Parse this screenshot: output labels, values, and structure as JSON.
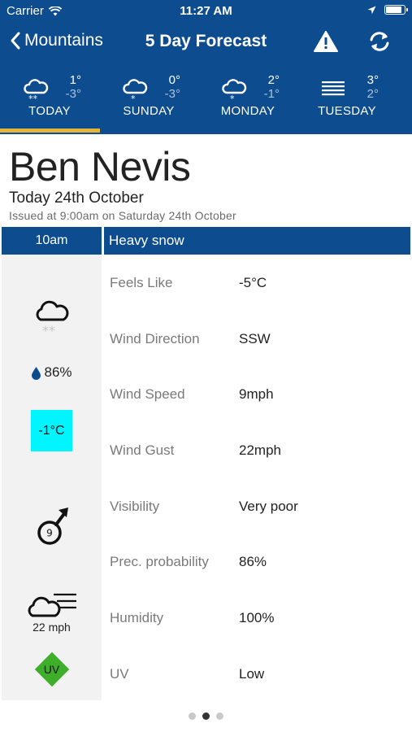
{
  "status_bar": {
    "carrier": "Carrier",
    "time": "11:27 AM"
  },
  "nav": {
    "back_label": "Mountains",
    "title": "5 Day Forecast",
    "warning_icon": "warning-triangle-icon",
    "refresh_icon": "refresh-icon"
  },
  "days": [
    {
      "label": "TODAY",
      "high": "1°",
      "low": "-3°",
      "icon": "heavy-snow-icon"
    },
    {
      "label": "SUNDAY",
      "high": "0°",
      "low": "-3°",
      "icon": "light-snow-icon"
    },
    {
      "label": "MONDAY",
      "high": "2°",
      "low": "-1°",
      "icon": "light-snow-icon"
    },
    {
      "label": "TUESDAY",
      "high": "3°",
      "low": "2°",
      "icon": "mist-icon"
    }
  ],
  "location": "Ben Nevis",
  "date": "Today 24th October",
  "issued": "Issued at 9:00am on Saturday 24th October",
  "forecast": {
    "time": "10am",
    "weather": "Heavy snow",
    "humidity_badge": "86%",
    "temperature_badge": "-1°C",
    "wind_direction_number": "9",
    "wind_badge": "22 mph",
    "uv_badge": "UV",
    "colors": {
      "temp_badge_bg": "#00f5ff",
      "uv_badge_bg": "#3fae2a",
      "header_bg": "#0d4c8f",
      "tab_indicator": "#e3b33a"
    }
  },
  "details": [
    {
      "label": "Feels Like",
      "value": "-5°C"
    },
    {
      "label": "Wind Direction",
      "value": "SSW"
    },
    {
      "label": "Wind Speed",
      "value": "9mph"
    },
    {
      "label": "Wind Gust",
      "value": "22mph"
    },
    {
      "label": "Visibility",
      "value": "Very poor"
    },
    {
      "label": "Prec. probability",
      "value": "86%"
    },
    {
      "label": "Humidity",
      "value": "100%"
    },
    {
      "label": "UV",
      "value": "Low"
    }
  ],
  "pager": {
    "pages": 3,
    "current": 2
  }
}
